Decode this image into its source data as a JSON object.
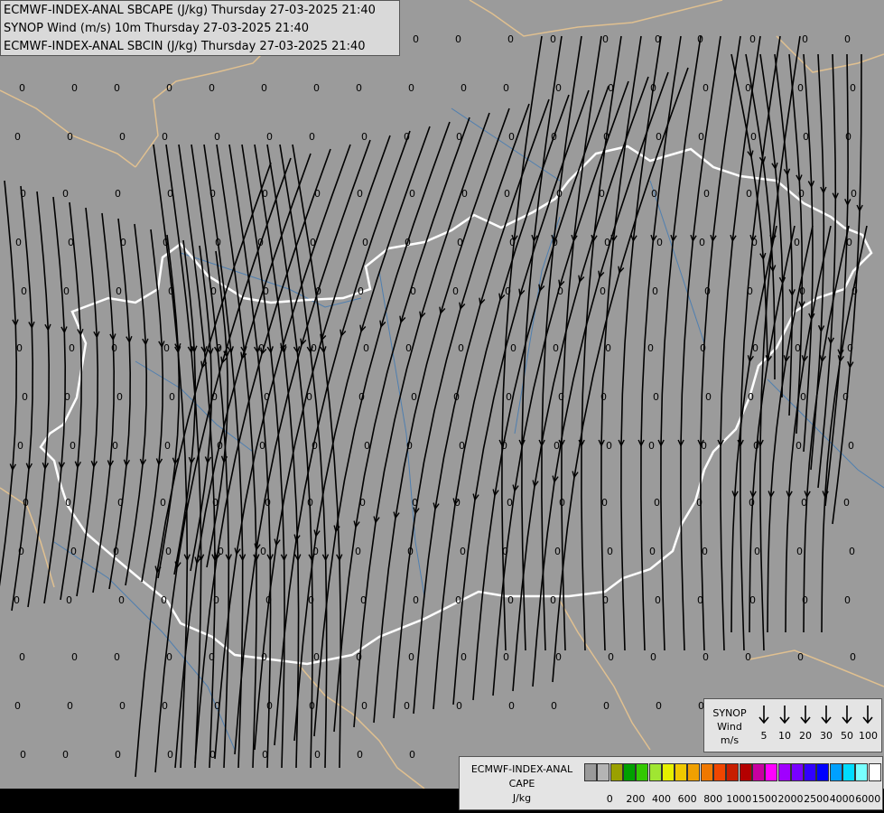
{
  "title": {
    "line1": "ECMWF-INDEX-ANAL SBCAPE (J/kg) Thursday 27-03-2025 21:40",
    "line2": "SYNOP Wind (m/s) 10m Thursday 27-03-2025 21:40",
    "line3": "ECMWF-INDEX-ANAL SBCIN (J/kg) Thursday 27-03-2025 21:40"
  },
  "map_value_label": "0",
  "wind_legend": {
    "label_line1": "SYNOP",
    "label_line2": "Wind",
    "label_line3": "m/s",
    "speeds": [
      "5",
      "10",
      "20",
      "30",
      "50",
      "100"
    ]
  },
  "cape_legend": {
    "label_line1": "ECMWF-INDEX-ANAL",
    "label_line2": "CAPE",
    "label_line3": "J/kg",
    "colors": [
      "#9a9a9a",
      "#b4b4b4",
      "#9aa000",
      "#00a000",
      "#32c800",
      "#a0e632",
      "#e6f000",
      "#f0c800",
      "#f0a000",
      "#f07800",
      "#f04600",
      "#c81e00",
      "#b40000",
      "#c800a0",
      "#ff00ff",
      "#a000ff",
      "#7800ff",
      "#3200ff",
      "#0000ff",
      "#00a0ff",
      "#00dcff",
      "#78ffff",
      "#ffffff"
    ],
    "ticks": [
      "0",
      "200",
      "400",
      "600",
      "800",
      "1000",
      "1500",
      "2000",
      "2500",
      "4000",
      "6000"
    ]
  },
  "colors": {
    "map_background": "#9b9b9b",
    "border": "#ffffff",
    "neighbour_border": "#e0c090",
    "river": "#4f7fb0",
    "streamline": "#000000"
  }
}
